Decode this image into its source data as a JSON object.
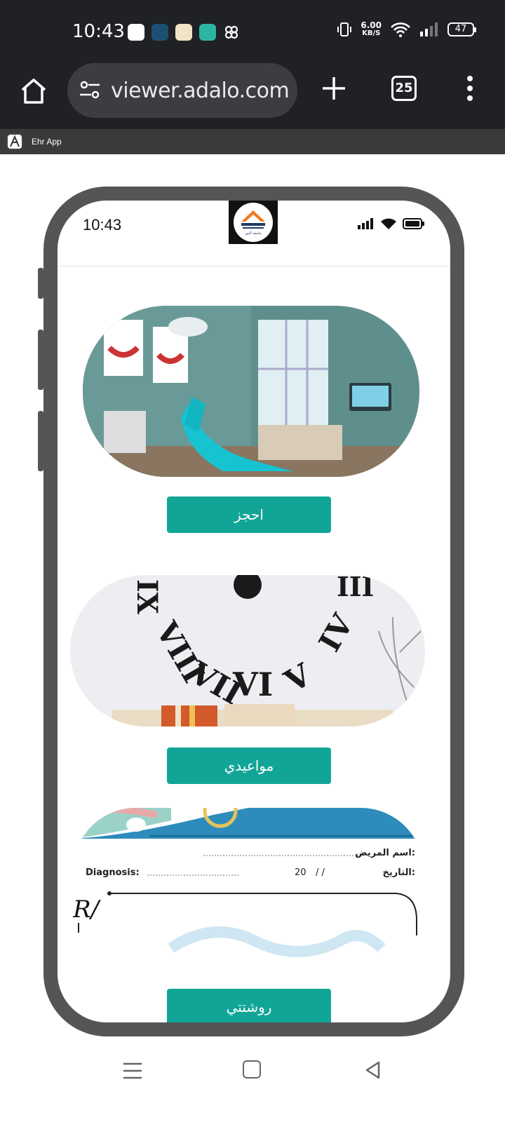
{
  "status_bar": {
    "time": "10:43",
    "net_speed": "6.00",
    "net_unit": "KB/S",
    "battery": "47"
  },
  "browser": {
    "url": "viewer.adalo.com",
    "tab_count": "25"
  },
  "pwa": {
    "app_name": "Ehr App"
  },
  "phone": {
    "time": "10:43",
    "logo_text": "جامعة النور",
    "buttons": {
      "book": "احجز",
      "appointments": "مواعيدي",
      "prescription": "روشتتي"
    },
    "prescription": {
      "patient_name_label": "اسم المريض:",
      "date_label": "التاريخ:",
      "diagnosis_label": "Diagnosis:",
      "year_prefix": "20",
      "date_slashes": "/     /",
      "rx_symbol": "R/"
    }
  },
  "colors": {
    "accent": "#11a597",
    "chrome_dark": "#202124",
    "phone_frame": "#555555"
  }
}
